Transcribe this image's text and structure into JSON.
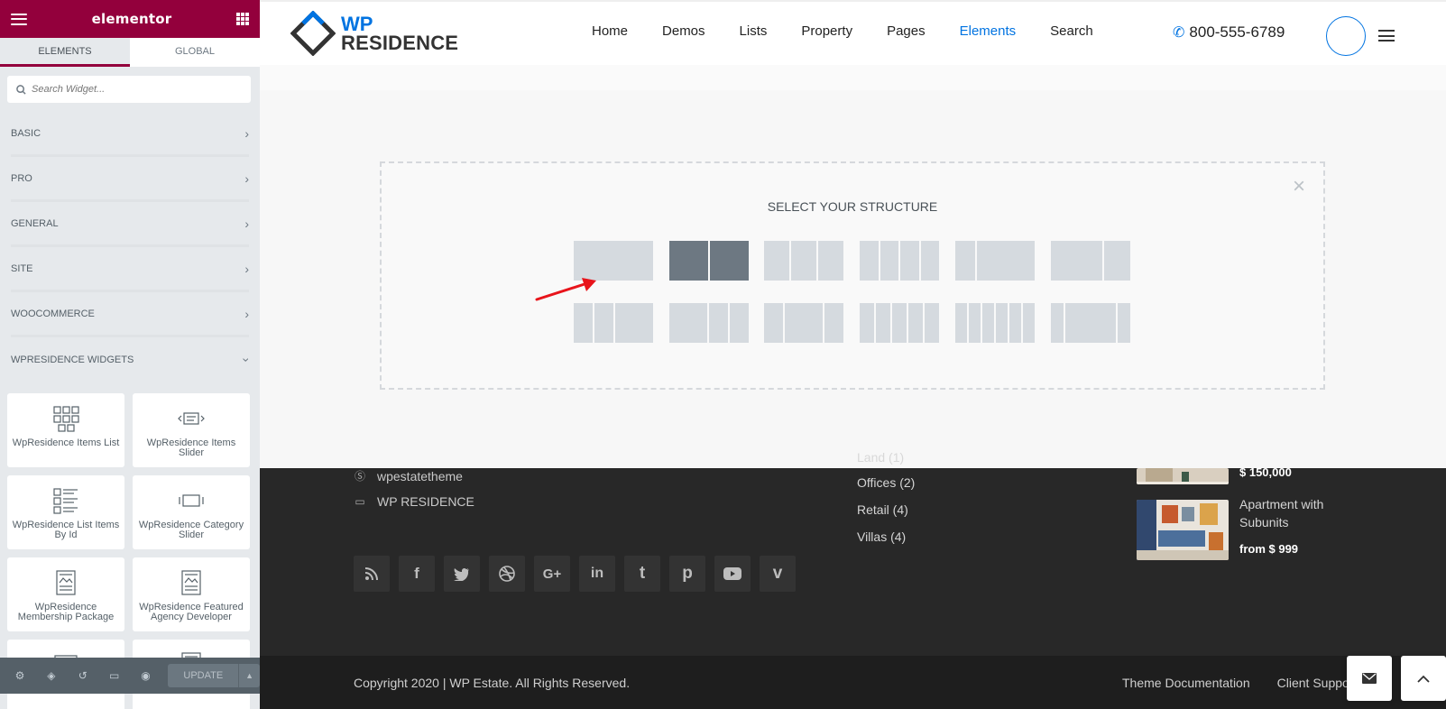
{
  "sidebar": {
    "brand": "elementor",
    "tabs": [
      "ELEMENTS",
      "GLOBAL"
    ],
    "search_placeholder": "Search Widget...",
    "categories": [
      "BASIC",
      "PRO",
      "GENERAL",
      "SITE",
      "WOOCOMMERCE",
      "WPRESIDENCE WIDGETS"
    ],
    "widgets": [
      "WpResidence Items List",
      "WpResidence Items Slider",
      "WpResidence List Items By Id",
      "WpResidence Category Slider",
      "WpResidence Membership Package",
      "WpResidence Featured Agency Developer",
      "",
      ""
    ],
    "update_label": "UPDATE"
  },
  "header": {
    "logo_top": "WP",
    "logo_bottom": "RESIDENCE",
    "nav": [
      "Home",
      "Demos",
      "Lists",
      "Property",
      "Pages",
      "Elements",
      "Search"
    ],
    "active_nav": "Elements",
    "phone": "800-555-6789"
  },
  "structure": {
    "title": "SELECT YOUR STRUCTURE",
    "close": "×",
    "selected_index": 1
  },
  "footer": {
    "contact": [
      {
        "icon": "skype-icon",
        "text": "wpestatetheme"
      },
      {
        "icon": "monitor-icon",
        "text": "WP RESIDENCE"
      }
    ],
    "social": [
      "rss-icon",
      "facebook-icon",
      "twitter-icon",
      "dribbble-icon",
      "google-plus-icon",
      "linkedin-icon",
      "tumblr-icon",
      "pinterest-icon",
      "youtube-icon",
      "vimeo-icon"
    ],
    "categories": [
      "Land  (1)",
      "Offices  (2)",
      "Retail  (4)",
      "Villas  (4)"
    ],
    "properties": [
      {
        "title": "",
        "price": "$ 150,000"
      },
      {
        "title": "Apartment with Subunits",
        "price": "from $ 999"
      }
    ],
    "copyright": "Copyright 2020 | WP Estate. All Rights Reserved.",
    "links": [
      "Theme Documentation",
      "Client Support"
    ]
  },
  "colors": {
    "elementor_brand": "#93003c",
    "accent_blue": "#0073e1",
    "arrow_red": "#e8141b"
  }
}
